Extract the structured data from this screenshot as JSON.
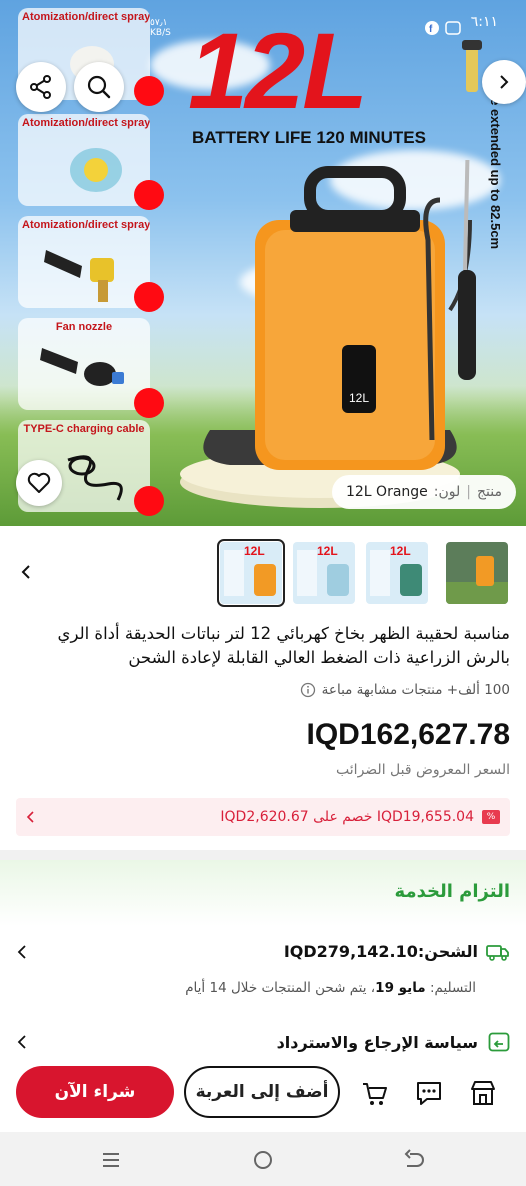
{
  "status_bar": {
    "time": "٦:١١",
    "speed": "٥٧٫١\nKB/S"
  },
  "hero": {
    "headline": "12L",
    "battery_text": "BATTERY LIFE 120 MINUTES",
    "extend_text": "Can be extended up to 82.5cm",
    "device_label": "12L",
    "feature_cards": [
      {
        "label": "Atomization/direct spray"
      },
      {
        "label": "Atomization/direct spray"
      },
      {
        "label": "Atomization/direct spray"
      },
      {
        "label": "Fan nozzle"
      },
      {
        "label": "TYPE-C charging cable"
      }
    ],
    "variant": {
      "prefix": "منتج",
      "color_label": "لون:",
      "value": "12L Orange"
    }
  },
  "thumbnails": [
    {
      "label": "12L",
      "color": "#f29a25"
    },
    {
      "label": "12L",
      "color": "#9fcde0"
    },
    {
      "label": "12L",
      "color": "#3e8a76"
    },
    {
      "label": "",
      "color": "#f29a25"
    }
  ],
  "product": {
    "title": "مناسبة لحقيبة الظهر بخاخ كهربائي 12 لتر نباتات الحديقة أداة الري بالرش الزراعية ذات الضغط العالي القابلة لإعادة الشحن",
    "sold_text": "100 ألف+ منتجات مشابهة مباعة",
    "price": "IQD162,627.78",
    "price_note": "السعر المعروض قبل الضرائب",
    "promo_badge": "%",
    "promo_text": "IQD19,655.04 خصم على IQD2,620.67"
  },
  "service": {
    "title": "التزام الخدمة",
    "shipping_label": "الشحن:",
    "shipping_value": "IQD279,142.10",
    "delivery_prefix": "التسليم:",
    "delivery_date": "مايو 19",
    "delivery_suffix": "، يتم شحن المنتجات خلال 14 أيام",
    "return_policy": "سياسة الإرجاع والاسترداد"
  },
  "actions": {
    "add_to_cart": "أضف إلى العربة",
    "buy_now": "شراء الآن"
  },
  "colors": {
    "accent_red": "#d8152e",
    "green": "#2b9b3b",
    "product_orange": "#f29a25"
  }
}
